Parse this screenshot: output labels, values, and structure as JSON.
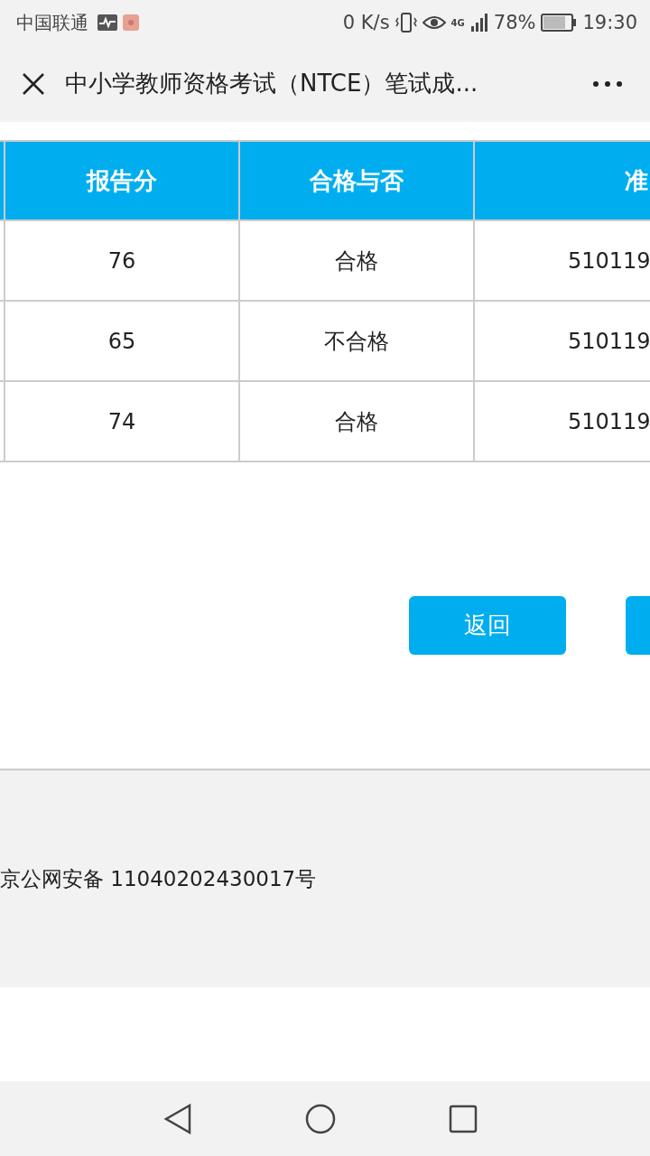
{
  "status_bar": {
    "carrier": "中国联通",
    "speed": "0 K/s",
    "network": "4G",
    "battery": "78%",
    "time": "19:30"
  },
  "title_bar": {
    "title": "中小学教师资格考试（NTCE）笔试成..."
  },
  "table": {
    "columns": [
      "报告分",
      "合格与否",
      "准"
    ],
    "rows": [
      {
        "score": "76",
        "result": "合格",
        "column_3": "510119"
      },
      {
        "score": "65",
        "result": "不合格",
        "column_3": "510119"
      },
      {
        "score": "74",
        "result": "合格",
        "column_3": "510119"
      }
    ]
  },
  "buttons": [
    "返回"
  ],
  "footer": {
    "text": "京公网安备 11040202430017号"
  }
}
